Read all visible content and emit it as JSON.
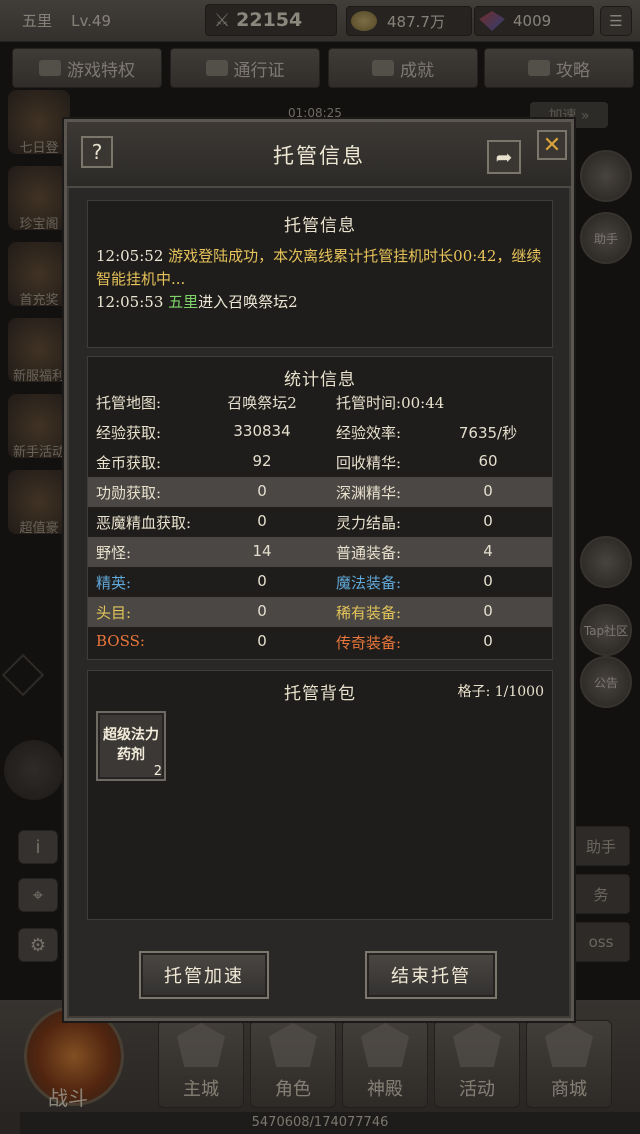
{
  "hud": {
    "player_name": "五里",
    "level": "Lv.49",
    "power": "22154",
    "gold": "487.7万",
    "gems": "4009",
    "tabs": [
      "游戏特权",
      "通行证",
      "成就",
      "攻略"
    ],
    "timer": "01:08:25",
    "speedup": "加速 »",
    "left_icons": [
      "七日登",
      "珍宝阁",
      "首充奖",
      "新服福利",
      "新手活动",
      "超值豪"
    ],
    "right_icons": [
      "",
      "助手",
      "",
      "Tap社区",
      "公告"
    ],
    "right_buttons": [
      "助手",
      "务",
      "oss"
    ],
    "bottom_nav": [
      "主城",
      "角色",
      "神殿",
      "活动",
      "商城"
    ],
    "battle_label": "战斗",
    "exp_text": "5470608/174077746",
    "exp_fraction": 0.031
  },
  "modal": {
    "title": "托管信息",
    "help": "?",
    "close": "✕",
    "log_panel": {
      "title": "托管信息",
      "lines": [
        {
          "time": "12:05:52",
          "msg": "游戏登陆成功，本次离线累计托管挂机时长00:42，继续智能挂机中..."
        },
        {
          "time": "12:05:53",
          "player": "五里",
          "txt": "进入召唤祭坛2"
        }
      ]
    },
    "stats_panel": {
      "title": "统计信息",
      "map_label": "托管地图:",
      "map_value": "召唤祭坛2",
      "time_label": "托管时间:",
      "time_value": "00:44",
      "rows": [
        {
          "k1": "经验获取:",
          "v1": "330834",
          "k2": "经验效率:",
          "v2": "7635/秒",
          "hl": false,
          "c1": "#e8e1cd",
          "c2": "#e8e1cd"
        },
        {
          "k1": "金币获取:",
          "v1": "92",
          "k2": "回收精华:",
          "v2": "60",
          "hl": false,
          "c1": "#e8e1cd",
          "c2": "#e8e1cd"
        },
        {
          "k1": "功勋获取:",
          "v1": "0",
          "k2": "深渊精华:",
          "v2": "0",
          "hl": true,
          "c1": "#e8e1cd",
          "c2": "#e8e1cd"
        },
        {
          "k1": "恶魔精血获取:",
          "v1": "0",
          "k2": "灵力结晶:",
          "v2": "0",
          "hl": false,
          "c1": "#e8e1cd",
          "c2": "#e8e1cd"
        },
        {
          "k1": "野怪:",
          "v1": "14",
          "k2": "普通装备:",
          "v2": "4",
          "hl": true,
          "c1": "#e8e1cd",
          "c2": "#e8e1cd"
        },
        {
          "k1": "精英:",
          "v1": "0",
          "k2": "魔法装备:",
          "v2": "0",
          "hl": false,
          "c1": "#5fa8d8",
          "c2": "#5fa8d8"
        },
        {
          "k1": "头目:",
          "v1": "0",
          "k2": "稀有装备:",
          "v2": "0",
          "hl": true,
          "c1": "#e3c55a",
          "c2": "#e3c55a"
        },
        {
          "k1": "BOSS:",
          "v1": "0",
          "k2": "传奇装备:",
          "v2": "0",
          "hl": false,
          "c1": "#e8763a",
          "c2": "#e8763a"
        }
      ]
    },
    "bag_panel": {
      "title": "托管背包",
      "capacity": "格子: 1/1000",
      "items": [
        {
          "name": "超级法力药剂",
          "count": "2"
        }
      ]
    },
    "buttons": {
      "speed": "托管加速",
      "end": "结束托管"
    }
  },
  "colors": {
    "accent_gold": "#e6c25a",
    "player_green": "#7fd36a",
    "elite_blue": "#5fa8d8",
    "boss_orange": "#e8763a"
  }
}
